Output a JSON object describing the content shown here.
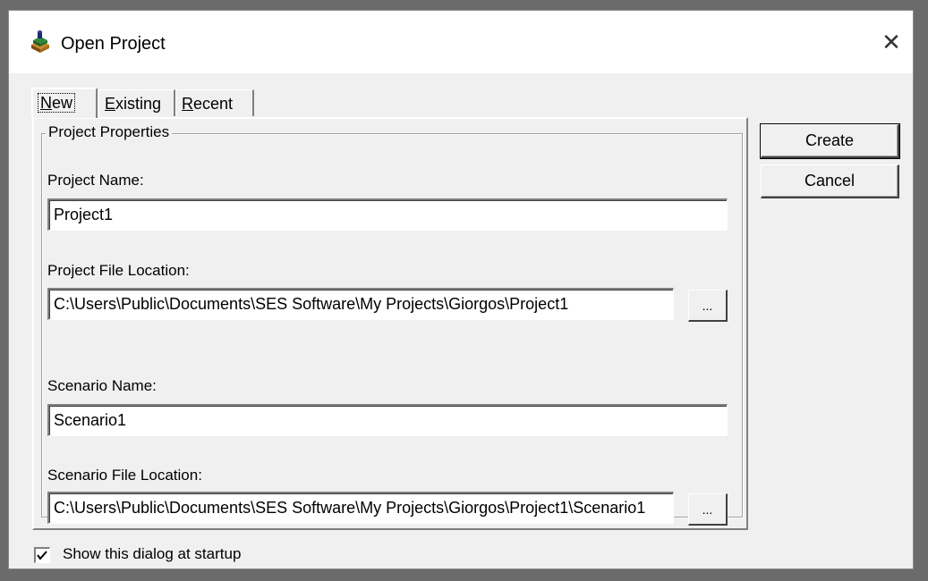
{
  "window": {
    "title": "Open Project",
    "close_glyph": "✕"
  },
  "tabs": [
    {
      "label_prefix": "",
      "accel": "N",
      "label_rest": "ew",
      "selected": true
    },
    {
      "label_prefix": "",
      "accel": "E",
      "label_rest": "xisting",
      "selected": false
    },
    {
      "label_prefix": "",
      "accel": "R",
      "label_rest": "ecent",
      "selected": false
    }
  ],
  "group": {
    "legend": "Project Properties"
  },
  "fields": {
    "project_name_label": "Project Name:",
    "project_name_value": "Project1",
    "project_location_label": "Project File Location:",
    "project_location_value": "C:\\Users\\Public\\Documents\\SES Software\\My Projects\\Giorgos\\Project1",
    "scenario_name_label": "Scenario Name:",
    "scenario_name_value": "Scenario1",
    "scenario_location_label": "Scenario File Location:",
    "scenario_location_value": "C:\\Users\\Public\\Documents\\SES Software\\My Projects\\Giorgos\\Project1\\Scenario1",
    "browse_label": "..."
  },
  "buttons": {
    "create": "Create",
    "cancel": "Cancel"
  },
  "startup": {
    "label": "Show this dialog at startup",
    "checked": true
  },
  "icons": {
    "app_icon": "project-book-icon",
    "close_icon": "close-icon"
  }
}
